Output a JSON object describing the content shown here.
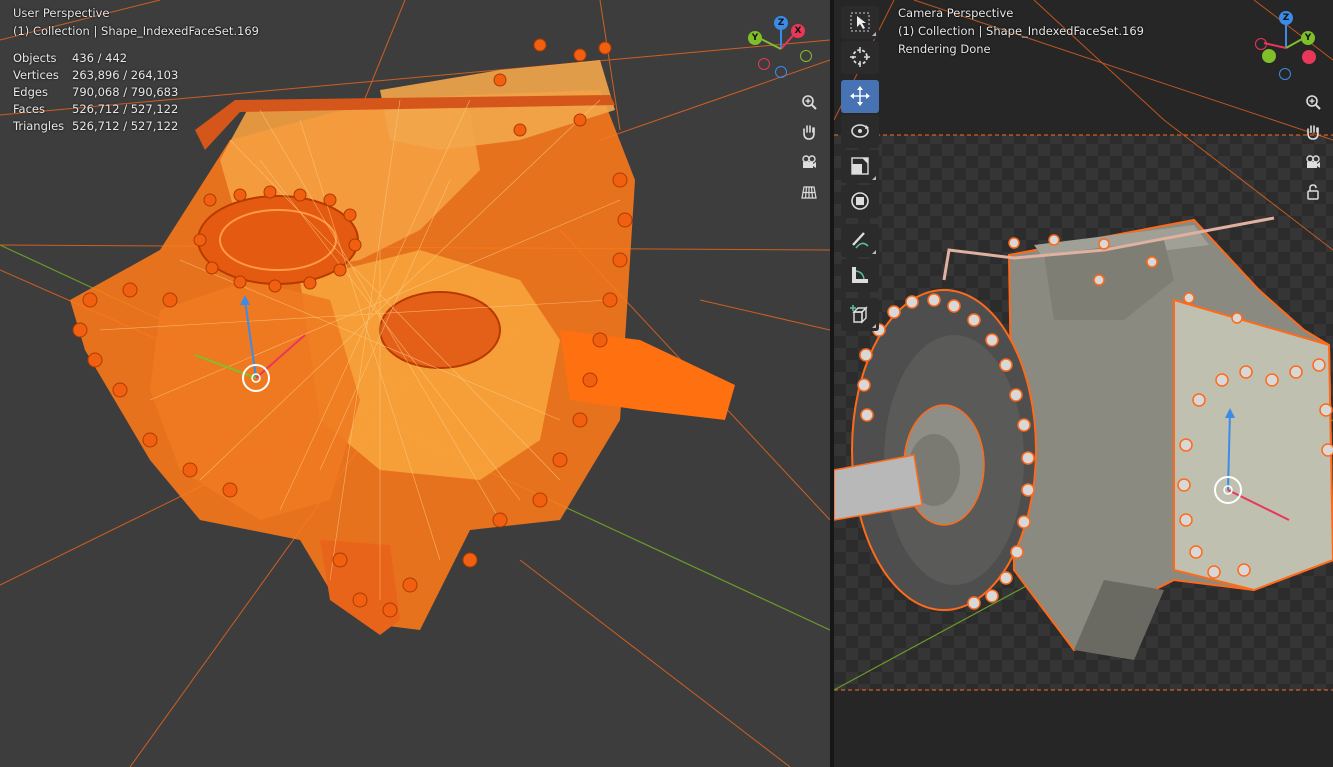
{
  "left_viewport": {
    "perspective": "User Perspective",
    "collection": "(1) Collection | Shape_IndexedFaceSet.169",
    "stats": [
      {
        "label": "Objects",
        "value": "436 / 442"
      },
      {
        "label": "Vertices",
        "value": "263,896 / 264,103"
      },
      {
        "label": "Edges",
        "value": "790,068 / 790,683"
      },
      {
        "label": "Faces",
        "value": "526,712 / 527,122"
      },
      {
        "label": "Triangles",
        "value": "526,712 / 527,122"
      }
    ]
  },
  "right_viewport": {
    "perspective": "Camera Perspective",
    "collection": "(1) Collection | Shape_IndexedFaceSet.169",
    "status": "Rendering Done"
  },
  "gizmo": {
    "x": "X",
    "y": "Y",
    "z": "Z"
  },
  "colors": {
    "selection_orange": "#ff6a1a",
    "wire_light": "#f7a43c",
    "axis_x": "#e8385a",
    "axis_y": "#7fbf2a",
    "axis_z": "#3b8ce8",
    "active_tool": "#4772b3"
  },
  "toolbar": [
    "select-box",
    "cursor",
    "move",
    "rotate",
    "scale",
    "transform",
    "annotate",
    "measure",
    "add-cube"
  ],
  "nav_buttons_left": [
    "zoom-icon",
    "hand-pan-icon",
    "camera-view-icon",
    "grid-view-icon"
  ],
  "nav_buttons_right": [
    "zoom-icon",
    "hand-pan-icon",
    "camera-view-icon",
    "lock-icon"
  ]
}
